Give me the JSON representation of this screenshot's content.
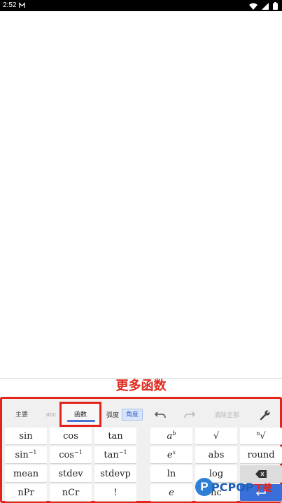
{
  "status_bar": {
    "time": "2:52"
  },
  "caption": "更多函数",
  "toolbar": {
    "tabs": [
      {
        "label": "主要"
      },
      {
        "label": "abc"
      },
      {
        "label": "函数"
      }
    ],
    "angle_units": {
      "radian": "弧度",
      "degree": "角度",
      "selected": "角度"
    },
    "clear_all": "清除全部"
  },
  "keys": {
    "sin": "sin",
    "cos": "cos",
    "tan": "tan",
    "sin_inv_base": "sin",
    "cos_inv_base": "cos",
    "tan_inv_base": "tan",
    "inv_exp": "−1",
    "mean": "mean",
    "stdev": "stdev",
    "stdevp": "stdevp",
    "npr": "nPr",
    "ncr": "nCr",
    "factorial": "!",
    "power_base": "a",
    "power_exp": "b",
    "sqrt": "√",
    "nthroot_index": "n",
    "nthroot": "√",
    "exp_base": "e",
    "exp_exp": "x",
    "abs": "abs",
    "round": "round",
    "ln": "ln",
    "log": "log",
    "e": "e",
    "nc": "nc"
  },
  "watermark": {
    "letter": "P",
    "brand": "PCPOP",
    "suffix": "下载"
  },
  "colors": {
    "accent_blue": "#3a6fd9",
    "highlight_red": "#e3241b",
    "panel_bg": "#f0f0f0"
  }
}
